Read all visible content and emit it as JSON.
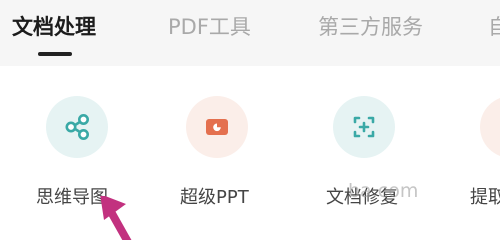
{
  "tabs": [
    {
      "label": "文档处理",
      "active": true
    },
    {
      "label": "PDF工具",
      "active": false
    },
    {
      "label": "第三方服务",
      "active": false
    },
    {
      "label": "自",
      "active": false
    }
  ],
  "tools": [
    {
      "label": "思维导图",
      "icon": "share-icon",
      "color": "#3aa9a6"
    },
    {
      "label": "超级PPT",
      "icon": "ppt-icon",
      "color": "#e4704f"
    },
    {
      "label": "文档修复",
      "icon": "document-repair-icon",
      "color": "#3aa9a6"
    },
    {
      "label": "提取",
      "icon": "extract-icon",
      "color": "#e4704f"
    }
  ],
  "watermark": "ba.com",
  "colors": {
    "tab_active": "#1c1c1c",
    "tab_inactive": "#a9a9a9",
    "teal_accent": "#3aa9a6",
    "orange_accent": "#e4704f",
    "pointer_arrow": "#c2317f"
  }
}
